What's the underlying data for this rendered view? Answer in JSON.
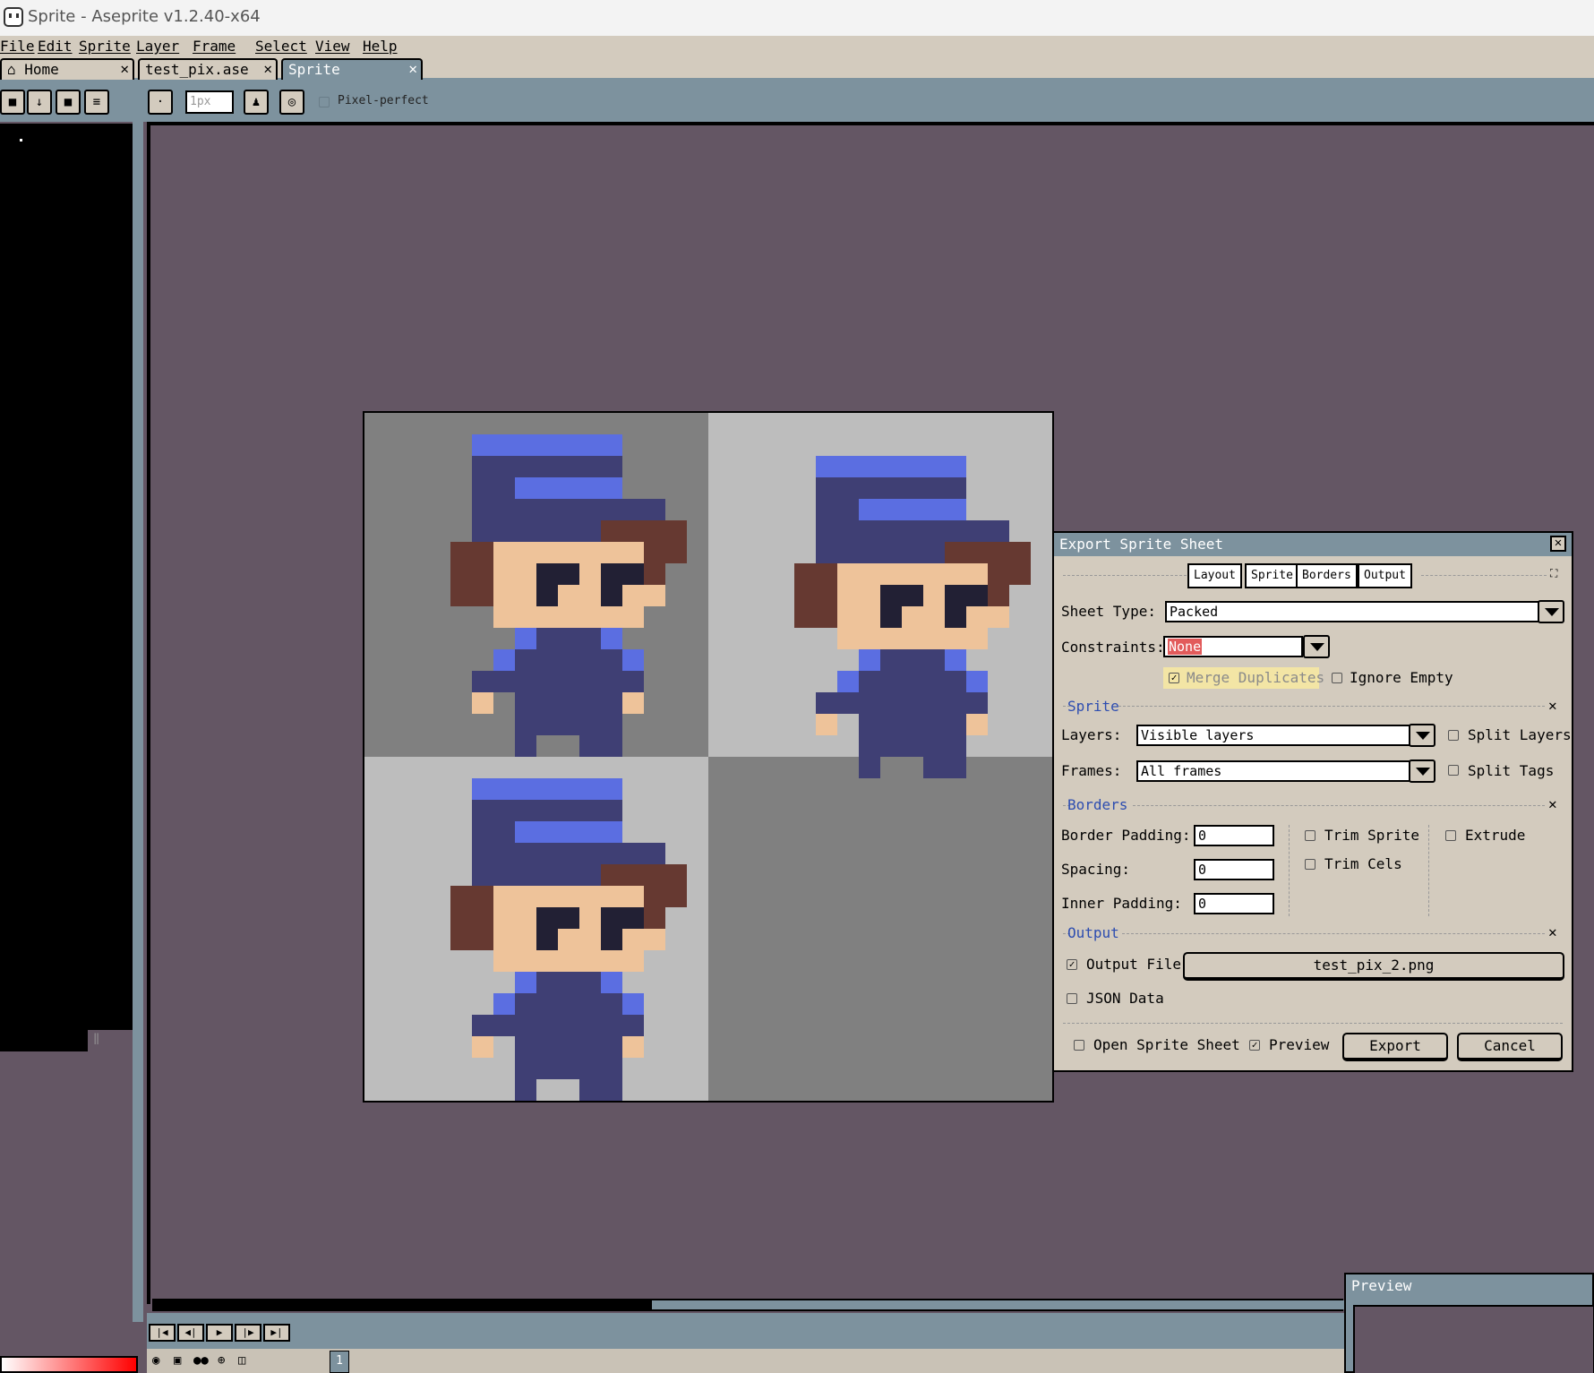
{
  "window": {
    "title": "Sprite - Aseprite v1.2.40-x64"
  },
  "menu": [
    "File",
    "Edit",
    "Sprite",
    "Layer",
    "Frame",
    "Select",
    "View",
    "Help"
  ],
  "tabs": [
    {
      "label": "Home",
      "close": "✕"
    },
    {
      "label": "test_pix.ase",
      "close": "✕"
    },
    {
      "label": "Sprite",
      "close": "✕"
    }
  ],
  "toolbar": {
    "brush_size_placeholder": "1px",
    "pixel_perfect_label": "Pixel-perfect"
  },
  "timeline": {
    "current_frame": "1"
  },
  "dialog": {
    "title": "Export Sprite Sheet",
    "tabs": [
      "Layout",
      "Sprite",
      "Borders",
      "Output"
    ],
    "sheet_type_label": "Sheet Type:",
    "sheet_type_value": "Packed",
    "constraints_label": "Constraints:",
    "constraints_value": "None",
    "merge_duplicates_label": "Merge Duplicates",
    "ignore_empty_label": "Ignore Empty",
    "sprite_section": "Sprite",
    "layers_label": "Layers:",
    "layers_value": "Visible layers",
    "split_layers_label": "Split Layers",
    "frames_label": "Frames:",
    "frames_value": "All frames",
    "split_tags_label": "Split Tags",
    "borders_section": "Borders",
    "border_padding_label": "Border Padding:",
    "border_padding_value": "0",
    "spacing_label": "Spacing:",
    "spacing_value": "0",
    "inner_padding_label": "Inner Padding:",
    "inner_padding_value": "0",
    "trim_sprite_label": "Trim Sprite",
    "trim_cels_label": "Trim Cels",
    "extrude_label": "Extrude",
    "output_section": "Output",
    "output_file_label": "Output File",
    "output_file_value": "test_pix_2.png",
    "json_data_label": "JSON Data",
    "open_sprite_sheet_label": "Open Sprite Sheet",
    "preview_label": "Preview",
    "export_button": "Export",
    "cancel_button": "Cancel",
    "close_glyph": "✕"
  },
  "preview_panel": {
    "title": "Preview"
  },
  "colors": {
    "workspace": "#645664",
    "panel": "#7d929e",
    "chrome": "#d3cbbe",
    "hat_dark": "#3f3f74",
    "hat_light": "#5b6ee1",
    "hair": "#663931",
    "skin": "#eec39a",
    "eyes": "#222034"
  }
}
